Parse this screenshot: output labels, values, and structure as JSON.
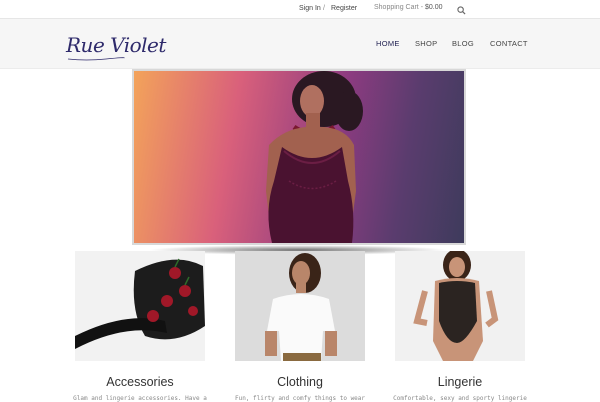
{
  "topbar": {
    "sign_in": "Sign In",
    "separator": "/",
    "register": "Register",
    "cart_label": "Shopping Cart - ",
    "cart_amount": "$0.00",
    "search_icon": "search-icon"
  },
  "header": {
    "logo_text": "Rue Violet",
    "nav": [
      "HOME",
      "SHOP",
      "BLOG",
      "CONTACT"
    ],
    "active_nav": "HOME",
    "accent_color": "#1f1f50"
  },
  "products": [
    {
      "title": "Accessories",
      "desc": "Glam and lingerie accessories. Have a"
    },
    {
      "title": "Clothing",
      "desc": "Fun, flirty and comfy things to wear"
    },
    {
      "title": "Lingerie",
      "desc": "Comfortable, sexy and sporty lingerie"
    }
  ]
}
